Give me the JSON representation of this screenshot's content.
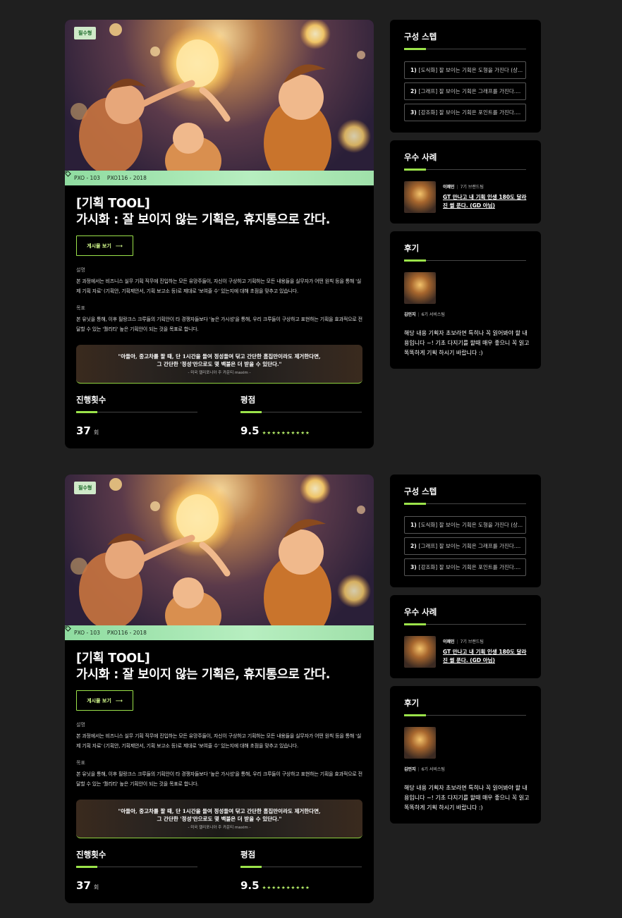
{
  "cards": [
    {
      "badge": "필수형",
      "tags": [
        "PXO - 103",
        "PXO116 - 2018"
      ],
      "title_line1": "[기획 TOOL]",
      "title_line2": "가시화 : 잘 보이지 않는 기획은, 휴지통으로 간다.",
      "view_button": "게시물 보기",
      "desc_label": "설명",
      "desc_text": "본 과정에서는 비즈니스 실무 기획 직무에 진입하는 모든 유망주들이, 자신이 구상하고 기획하는 모든 내용들을 실무자가 어떤 원칙 등을 통해 '실제 기획 자료' (기획안, 기획제안서, 기획 보고소 등)로 제대로 '보여줄 수' 있는지에 대해 초점을 맞추고 있습니다.",
      "goal_label": "목표",
      "goal_text": "본 유닛을 통해, 이후 필랑크스 크루들의 기획안이 타 경쟁자들보다 '높은 가시성'을 통해, 우리 크루들이 구상하고 표현하는 기획을 효과적으로 전달할 수 있는 '퀄리티' 높은 기획안이 되는 것을 목표로 합니다.",
      "quote_line1": "\"아들아, 중고차를 팔 때, 단 1시간을 들여 정성들여 닦고 간단한 흠집만이라도 제거한다면,",
      "quote_line2": "그 간단한 '정성'만으로도 몇 백불은 더 받을 수 있단다.\"",
      "quote_source": "- 미국 캘리포니아 주 카운티 maxim -",
      "count_label": "진행횟수",
      "count_value": "37",
      "count_unit": "회",
      "rating_label": "평점",
      "rating_value": "9.5",
      "rating_stars": "★★★★★★★★★★",
      "steps_title": "구성 스텝",
      "steps": [
        {
          "num": "1)",
          "text": "[도식화] 잘 보이는 기획은 도형을 가진다 (상..."
        },
        {
          "num": "2)",
          "text": "[그래프] 잘 보이는 기획은 그래프를 가진다...."
        },
        {
          "num": "3)",
          "text": "[강조화] 잘 보이는 기획은 포인트를 가진다...."
        }
      ],
      "examples_title": "우수 사례",
      "example_author": "이혜인",
      "example_cohort": "7기 브랜드팀",
      "example_title": "GT 만나고 내 기획 인생 180도 달라진 썰 푼다. (GD 아님)",
      "review_title": "후기",
      "review_author": "김민지",
      "review_cohort": "6기 서비스팀",
      "review_text": "해당 내용 기획자 초보라면 특히나 꼭 읽어봐야 할 내용입니다 ~! 기초 다지기를 할때 매우 좋으니 꼭 읽고 똑똑하게 기획 하시기 바랍니다 :)"
    },
    {
      "badge": "필수형",
      "tags": [
        "PXO - 103",
        "PXO116 - 2018"
      ],
      "title_line1": "[기획 TOOL]",
      "title_line2": "가시화 : 잘 보이지 않는 기획은, 휴지통으로 간다.",
      "view_button": "게시물 보기",
      "desc_label": "설명",
      "desc_text": "본 과정에서는 비즈니스 실무 기획 직무에 진입하는 모든 유망주들이, 자신이 구상하고 기획하는 모든 내용들을 실무자가 어떤 원칙 등을 통해 '실제 기획 자료' (기획안, 기획제안서, 기획 보고소 등)로 제대로 '보여줄 수' 있는지에 대해 초점을 맞추고 있습니다.",
      "goal_label": "목표",
      "goal_text": "본 유닛을 통해, 이후 필랑크스 크루들의 기획안이 타 경쟁자들보다 '높은 가시성'을 통해, 우리 크루들이 구상하고 표현하는 기획을 효과적으로 전달할 수 있는 '퀄리티' 높은 기획안이 되는 것을 목표로 합니다.",
      "quote_line1": "\"아들아, 중고차를 팔 때, 단 1시간을 들여 정성들여 닦고 간단한 흠집만이라도 제거한다면,",
      "quote_line2": "그 간단한 '정성'만으로도 몇 백불은 더 받을 수 있단다.\"",
      "quote_source": "- 미국 캘리포니아 주 카운티 maxim -",
      "count_label": "진행횟수",
      "count_value": "37",
      "count_unit": "회",
      "rating_label": "평점",
      "rating_value": "9.5",
      "rating_stars": "★★★★★★★★★★",
      "steps_title": "구성 스텝",
      "steps": [
        {
          "num": "1)",
          "text": "[도식화] 잘 보이는 기획은 도형을 가진다 (상..."
        },
        {
          "num": "2)",
          "text": "[그래프] 잘 보이는 기획은 그래프를 가진다...."
        },
        {
          "num": "3)",
          "text": "[강조화] 잘 보이는 기획은 포인트를 가진다...."
        }
      ],
      "examples_title": "우수 사례",
      "example_author": "이혜인",
      "example_cohort": "7기 브랜드팀",
      "example_title": "GT 만나고 내 기획 인생 180도 달라진 썰 푼다. (GD 아님)",
      "review_title": "후기",
      "review_author": "김민지",
      "review_cohort": "6기 서비스팀",
      "review_text": "해당 내용 기획자 초보라면 특히나 꼭 읽어봐야 할 내용입니다 ~! 기초 다지기를 할때 매우 좋으니 꼭 읽고 똑똑하게 기획 하시기 바랍니다 :)"
    }
  ],
  "colors": {
    "page_bg": "#1f1f1f",
    "card_bg": "#000000",
    "accent": "#9be34a",
    "tagbar": "#b7eec0",
    "badge_bg": "#cfe9c9"
  }
}
